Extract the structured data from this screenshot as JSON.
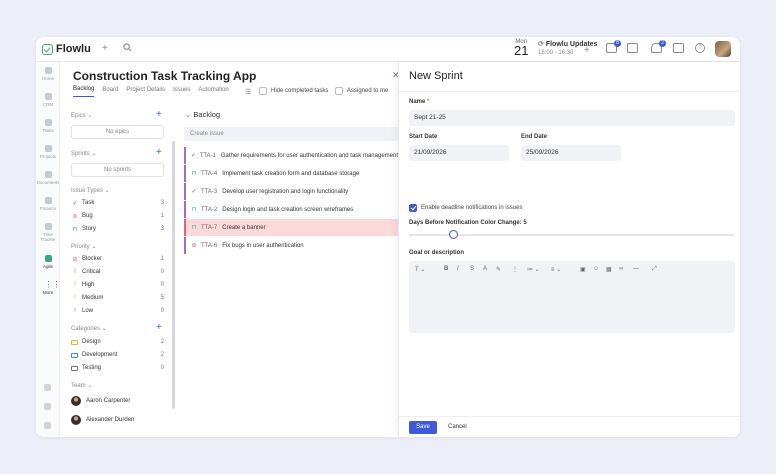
{
  "topbar": {
    "brand": "Flowlu",
    "date": {
      "dow": "Mon",
      "day": "21"
    },
    "event": {
      "title": "Flowlu Updates",
      "time": "16:00 - 16:30"
    },
    "badges": {
      "inbox": "8",
      "bell": "2"
    }
  },
  "sidebar": {
    "items": [
      {
        "label": "Home",
        "icon": "home-icon"
      },
      {
        "label": "CRM",
        "icon": "crm-icon"
      },
      {
        "label": "Tasks",
        "icon": "tasks-icon"
      },
      {
        "label": "Projects",
        "icon": "projects-icon"
      },
      {
        "label": "Documents",
        "icon": "documents-icon"
      },
      {
        "label": "Finance",
        "icon": "finance-icon"
      },
      {
        "label": "Time Tracker",
        "icon": "time-tracker-icon"
      },
      {
        "label": "Agile",
        "icon": "agile-icon"
      },
      {
        "label": "More",
        "icon": "grid-icon"
      }
    ]
  },
  "project": {
    "title": "Construction Task Tracking App",
    "tabs": [
      "Backlog",
      "Board",
      "Project Details",
      "Issues",
      "Automation"
    ],
    "hide_completed": "Hide completed tasks",
    "assigned_to_me": "Assigned to me"
  },
  "left_panel": {
    "epics_label": "Epics",
    "no_epics": "No epics",
    "sprints_label": "Sprints",
    "no_sprints": "No sprints",
    "issue_types_label": "Issue Types",
    "issue_types": [
      {
        "name": "Task",
        "count": "3",
        "icon": "check-icon",
        "color": "#3d5bd9"
      },
      {
        "name": "Bug",
        "count": "1",
        "icon": "bug-icon",
        "color": "#e0676f"
      },
      {
        "name": "Story",
        "count": "3",
        "icon": "bookmark-icon",
        "color": "#2fa3a3"
      }
    ],
    "priority_label": "Priority",
    "priorities": [
      {
        "name": "Blocker",
        "count": "1",
        "icon": "blocker-icon",
        "color": "#e0565f"
      },
      {
        "name": "Critical",
        "count": "0",
        "icon": "exclamation-icon",
        "color": "#e0565f"
      },
      {
        "name": "High",
        "count": "0",
        "icon": "exclamation-icon",
        "color": "#f08a24"
      },
      {
        "name": "Medium",
        "count": "5",
        "icon": "exclamation-icon",
        "color": "#f0b324"
      },
      {
        "name": "Low",
        "count": "0",
        "icon": "exclamation-icon",
        "color": "#3aa67e"
      }
    ],
    "categories_label": "Categories",
    "categories": [
      {
        "name": "Design",
        "count": "2",
        "color": "#e8b52a"
      },
      {
        "name": "Development",
        "count": "2",
        "color": "#2fa3a3"
      },
      {
        "name": "Testing",
        "count": "0",
        "color": "#6b7280"
      }
    ],
    "team_label": "Team",
    "team": [
      "Aaron Carpenter",
      "Alexander Durden"
    ]
  },
  "backlog": {
    "title": "Backlog",
    "create_issue": "Create issue",
    "issues": [
      {
        "key": "TTA-1",
        "title": "Gather requirements for user authentication and task management",
        "icon": "check-icon",
        "color": "#3d5bd9"
      },
      {
        "key": "TTA-4",
        "title": "Implement task creation form and database storage",
        "icon": "bookmark-icon",
        "color": "#2fa3a3"
      },
      {
        "key": "TTA-3",
        "title": "Develop user registration and login functionality",
        "icon": "check-icon",
        "color": "#3d5bd9"
      },
      {
        "key": "TTA-2",
        "title": "Design login and task creation screen wireframes",
        "icon": "bookmark-icon",
        "color": "#2fa3a3"
      },
      {
        "key": "TTA-7",
        "title": "Create a banner",
        "icon": "bookmark-icon",
        "color": "#2fa3a3"
      },
      {
        "key": "TTA-6",
        "title": "Fix bugs in user authentication",
        "icon": "bug-icon",
        "color": "#e0676f"
      }
    ]
  },
  "sprint": {
    "title": "New Sprint",
    "name_label": "Name",
    "required_mark": "*",
    "name_value": "Sept 21-25",
    "start_label": "Start Date",
    "start_value": "21/09/2026",
    "end_label": "End Date",
    "end_value": "25/09/2026",
    "notify_label": "Enable deadline notifications in issues",
    "days_label": "Days Before Notification Color Change: 5",
    "days_value": 5,
    "goal_label": "Goal or description",
    "save": "Save",
    "cancel": "Cancel"
  }
}
